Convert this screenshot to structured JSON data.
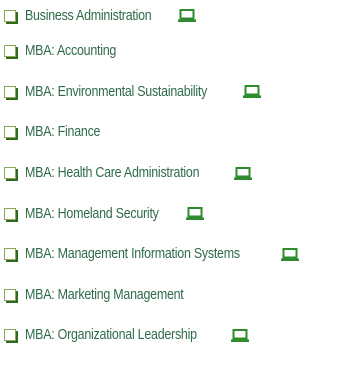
{
  "programs": [
    {
      "label": "Business Administration",
      "online": true
    },
    {
      "label": "MBA: Accounting",
      "online": false
    },
    {
      "label": "MBA: Environmental Sustainability",
      "online": true
    },
    {
      "label": "MBA: Finance",
      "online": false
    },
    {
      "label": "MBA: Health Care Administration",
      "online": true
    },
    {
      "label": "MBA: Homeland Security",
      "online": true
    },
    {
      "label": "MBA: Management Information Systems",
      "online": true
    },
    {
      "label": "MBA: Marketing Management",
      "online": false
    },
    {
      "label": "MBA: Organizational Leadership",
      "online": true
    }
  ],
  "icons": {
    "bullet": "checkbox-icon",
    "online_marker": "laptop-icon"
  },
  "colors": {
    "link_text": "#2f6b4a",
    "icon_green": "#2e8b2e",
    "bullet_shadow": "#2e6b1f"
  }
}
